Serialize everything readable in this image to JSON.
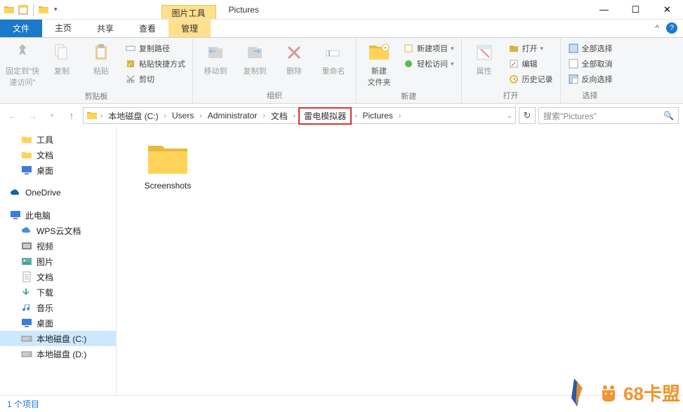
{
  "window": {
    "context_tab": "图片工具",
    "title": "Pictures"
  },
  "tabs": {
    "file": "文件",
    "home": "主页",
    "share": "共享",
    "view": "查看",
    "manage": "管理"
  },
  "ribbon": {
    "clipboard": {
      "pin": "固定到\"快\n速访问\"",
      "copy": "复制",
      "paste": "粘贴",
      "copy_path": "复制路径",
      "paste_shortcut": "粘贴快捷方式",
      "cut": "剪切",
      "group": "剪贴板"
    },
    "organize": {
      "move_to": "移动到",
      "copy_to": "复制到",
      "delete": "删除",
      "rename": "重命名",
      "group": "组织"
    },
    "new": {
      "new_folder": "新建\n文件夹",
      "new_item": "新建项目",
      "easy_access": "轻松访问",
      "group": "新建"
    },
    "open": {
      "properties": "属性",
      "open": "打开",
      "edit": "编辑",
      "history": "历史记录",
      "group": "打开"
    },
    "select": {
      "select_all": "全部选择",
      "select_none": "全部取消",
      "invert": "反向选择",
      "group": "选择"
    }
  },
  "breadcrumbs": [
    "本地磁盘 (C:)",
    "Users",
    "Administrator",
    "文档",
    "雷电模拟器",
    "Pictures"
  ],
  "search": {
    "placeholder": "搜索\"Pictures\""
  },
  "sidebar": {
    "quick": [
      "工具",
      "文档",
      "桌面"
    ],
    "onedrive": "OneDrive",
    "thispc": "此电脑",
    "thispc_items": [
      "WPS云文档",
      "视频",
      "图片",
      "文档",
      "下载",
      "音乐",
      "桌面",
      "本地磁盘 (C:)",
      "本地磁盘 (D:)"
    ]
  },
  "content": {
    "items": [
      "Screenshots"
    ]
  },
  "status": {
    "count": "1 个项目"
  },
  "watermark": {
    "text": "68卡盟"
  }
}
